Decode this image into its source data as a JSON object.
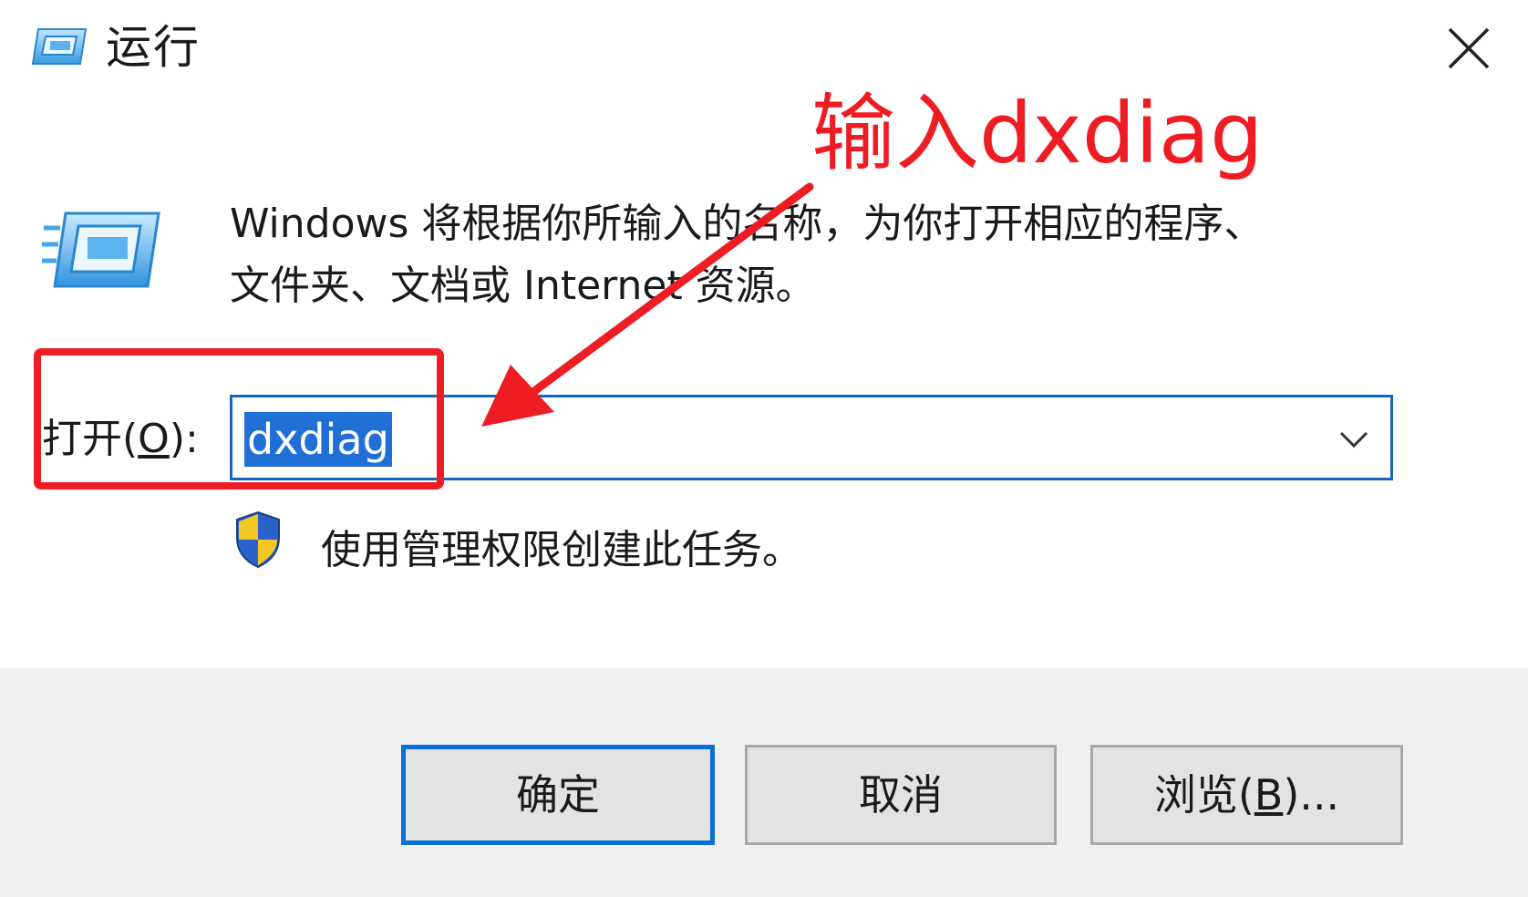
{
  "window": {
    "title": "运行",
    "close_icon": "close-icon"
  },
  "dialog": {
    "description_line1": "Windows 将根据你所输入的名称，为你打开相应的程序、",
    "description_line2": "文件夹、文档或 Internet 资源。",
    "open_label_prefix": "打开(",
    "open_label_accel": "O",
    "open_label_suffix": "):",
    "open_value": "dxdiag",
    "admin_note": "使用管理权限创建此任务。",
    "icons": {
      "app": "run-dialog-icon",
      "shield": "uac-shield-icon",
      "dropdown": "chevron-down-icon"
    }
  },
  "buttons": {
    "ok": "确定",
    "cancel": "取消",
    "browse_prefix": "浏览(",
    "browse_accel": "B",
    "browse_suffix": ")..."
  },
  "annotation": {
    "text": "输入dxdiag",
    "color": "#ee1d23"
  },
  "colors": {
    "accent": "#0a6fd8",
    "selection": "#1f6fd6",
    "footer_bg": "#f0f0f0"
  }
}
